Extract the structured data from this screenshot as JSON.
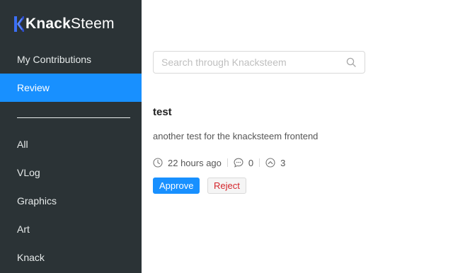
{
  "sidebar": {
    "logo": {
      "part1": "Knack",
      "part2": "Steem",
      "icon": "knacksteem-k-logo"
    },
    "items": [
      {
        "label": "My Contributions"
      },
      {
        "label": "Review",
        "active": true
      },
      {
        "label": "All"
      },
      {
        "label": "VLog"
      },
      {
        "label": "Graphics"
      },
      {
        "label": "Art"
      },
      {
        "label": "Knack"
      }
    ]
  },
  "search": {
    "placeholder": "Search through Knacksteem",
    "value": "",
    "icon": "search-icon"
  },
  "post": {
    "title": "test",
    "description": "another test for the knacksteem frontend",
    "time": "22 hours ago",
    "comments": "0",
    "votes": "3",
    "approve_label": "Approve",
    "reject_label": "Reject"
  },
  "colors": {
    "sidebar_bg": "#2b3336",
    "accent": "#1890ff",
    "reject_text": "#d4242a"
  }
}
